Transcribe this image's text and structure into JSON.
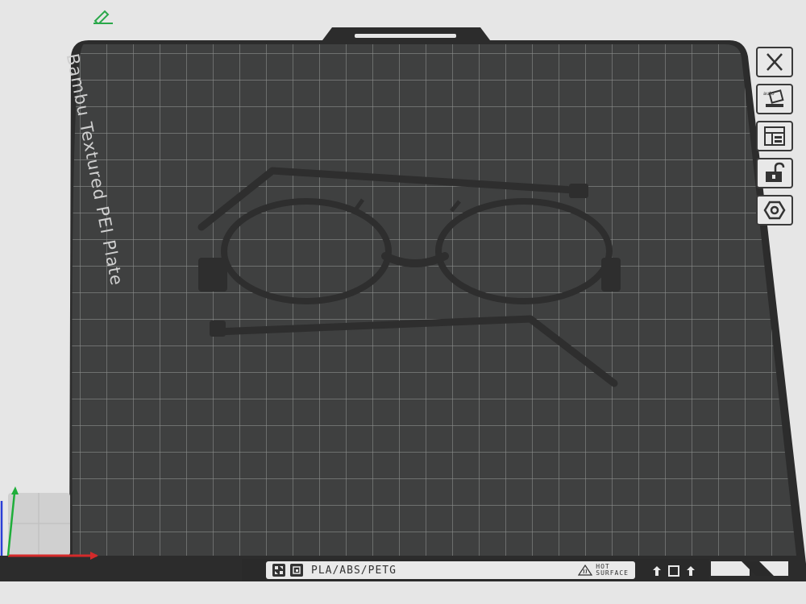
{
  "plate": {
    "label": "Bambu Textured PEI Plate"
  },
  "bottom_strip": {
    "material": "PLA/ABS/PETG",
    "hot_line1": "HOT",
    "hot_line2": "SURFACE"
  },
  "toolbar": {
    "items": [
      {
        "icon": "close-icon"
      },
      {
        "icon": "auto-orient-icon"
      },
      {
        "icon": "arrange-layout-icon"
      },
      {
        "icon": "lock-icon"
      },
      {
        "icon": "nut-settings-icon"
      }
    ]
  },
  "colors": {
    "plate": "#3f4040",
    "plate_frame": "#2a2a2a",
    "grid": "#8b8c8b",
    "model": "#2e2e2e",
    "axis_x": "#d42a2a",
    "axis_y": "#1fae3a",
    "axis_z": "#2c3fd6",
    "edit_icon": "#2aa84a"
  }
}
